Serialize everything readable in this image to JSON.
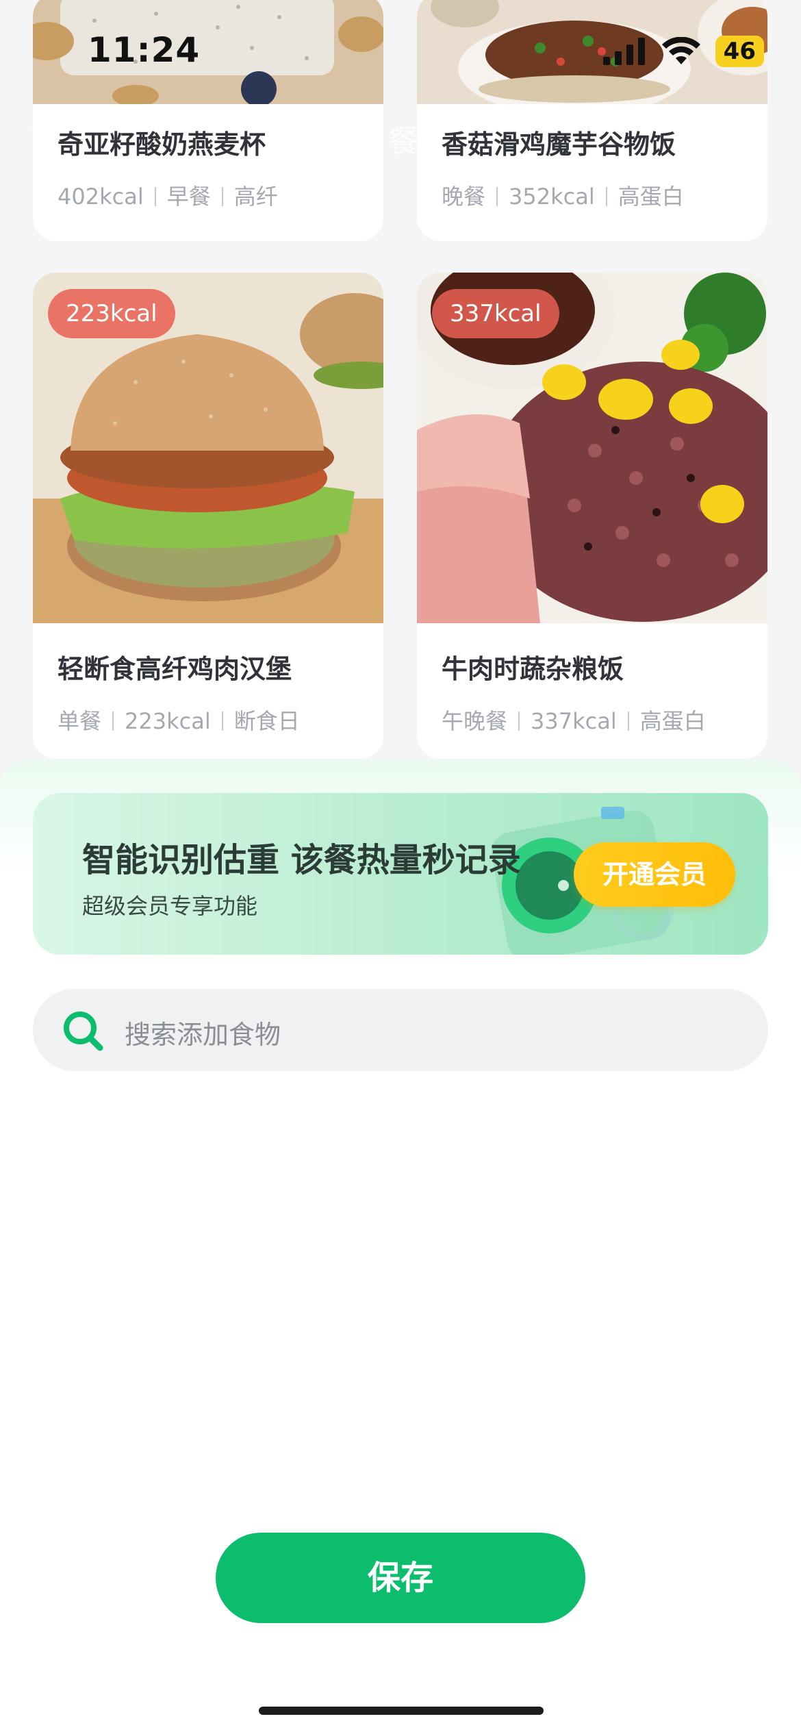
{
  "status_bar": {
    "time": "11:24",
    "battery": "46"
  },
  "nav": {
    "title_partial": "口餐"
  },
  "recipes": [
    {
      "title": "奇亚籽酸奶燕麦杯",
      "meta": [
        "402kcal",
        "早餐",
        "高纤"
      ]
    },
    {
      "title": "香菇滑鸡魔芋谷物饭",
      "meta": [
        "晚餐",
        "352kcal",
        "高蛋白"
      ]
    },
    {
      "title": "轻断食高纤鸡肉汉堡",
      "badge": "223kcal",
      "meta": [
        "单餐",
        "223kcal",
        "断食日"
      ]
    },
    {
      "title": "牛肉时蔬杂粮饭",
      "badge": "337kcal",
      "meta": [
        "午晚餐",
        "337kcal",
        "高蛋白"
      ]
    }
  ],
  "banner": {
    "headline": "智能识别估重 该餐热量秒记录",
    "subtitle": "超级会员专享功能",
    "button_label": "开通会员"
  },
  "search": {
    "placeholder": "搜索添加食物"
  },
  "footer": {
    "save_label": "保存"
  },
  "colors": {
    "accent_green": "#0bbd6c",
    "vip_yellow": "#ffc414",
    "kcal_badge": "#e86054"
  }
}
